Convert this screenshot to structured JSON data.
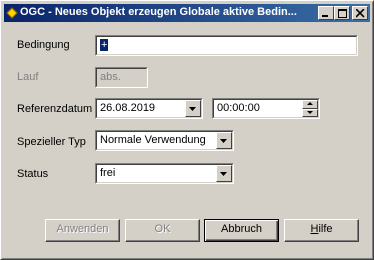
{
  "window": {
    "title": "OGC - Neues Objekt erzeugen Globale aktive Bedin..."
  },
  "form": {
    "bedingung": {
      "label": "Bedingung",
      "value": "+"
    },
    "lauf": {
      "label": "Lauf",
      "value": "abs."
    },
    "referenzdatum": {
      "label": "Referenzdatum",
      "date": "26.08.2019",
      "time": "00:00:00"
    },
    "spezieller_typ": {
      "label": "Spezieller Typ",
      "value": "Normale Verwendung"
    },
    "status": {
      "label": "Status",
      "value": "frei"
    }
  },
  "buttons": {
    "anwenden": "Anwenden",
    "ok": "OK",
    "abbruch": "Abbruch",
    "hilfe_prefix": "H",
    "hilfe_rest": "ilfe"
  },
  "icons": {
    "app": "diamond-icon",
    "minimize": "minimize-icon",
    "maximize": "maximize-icon",
    "close": "close-icon"
  }
}
